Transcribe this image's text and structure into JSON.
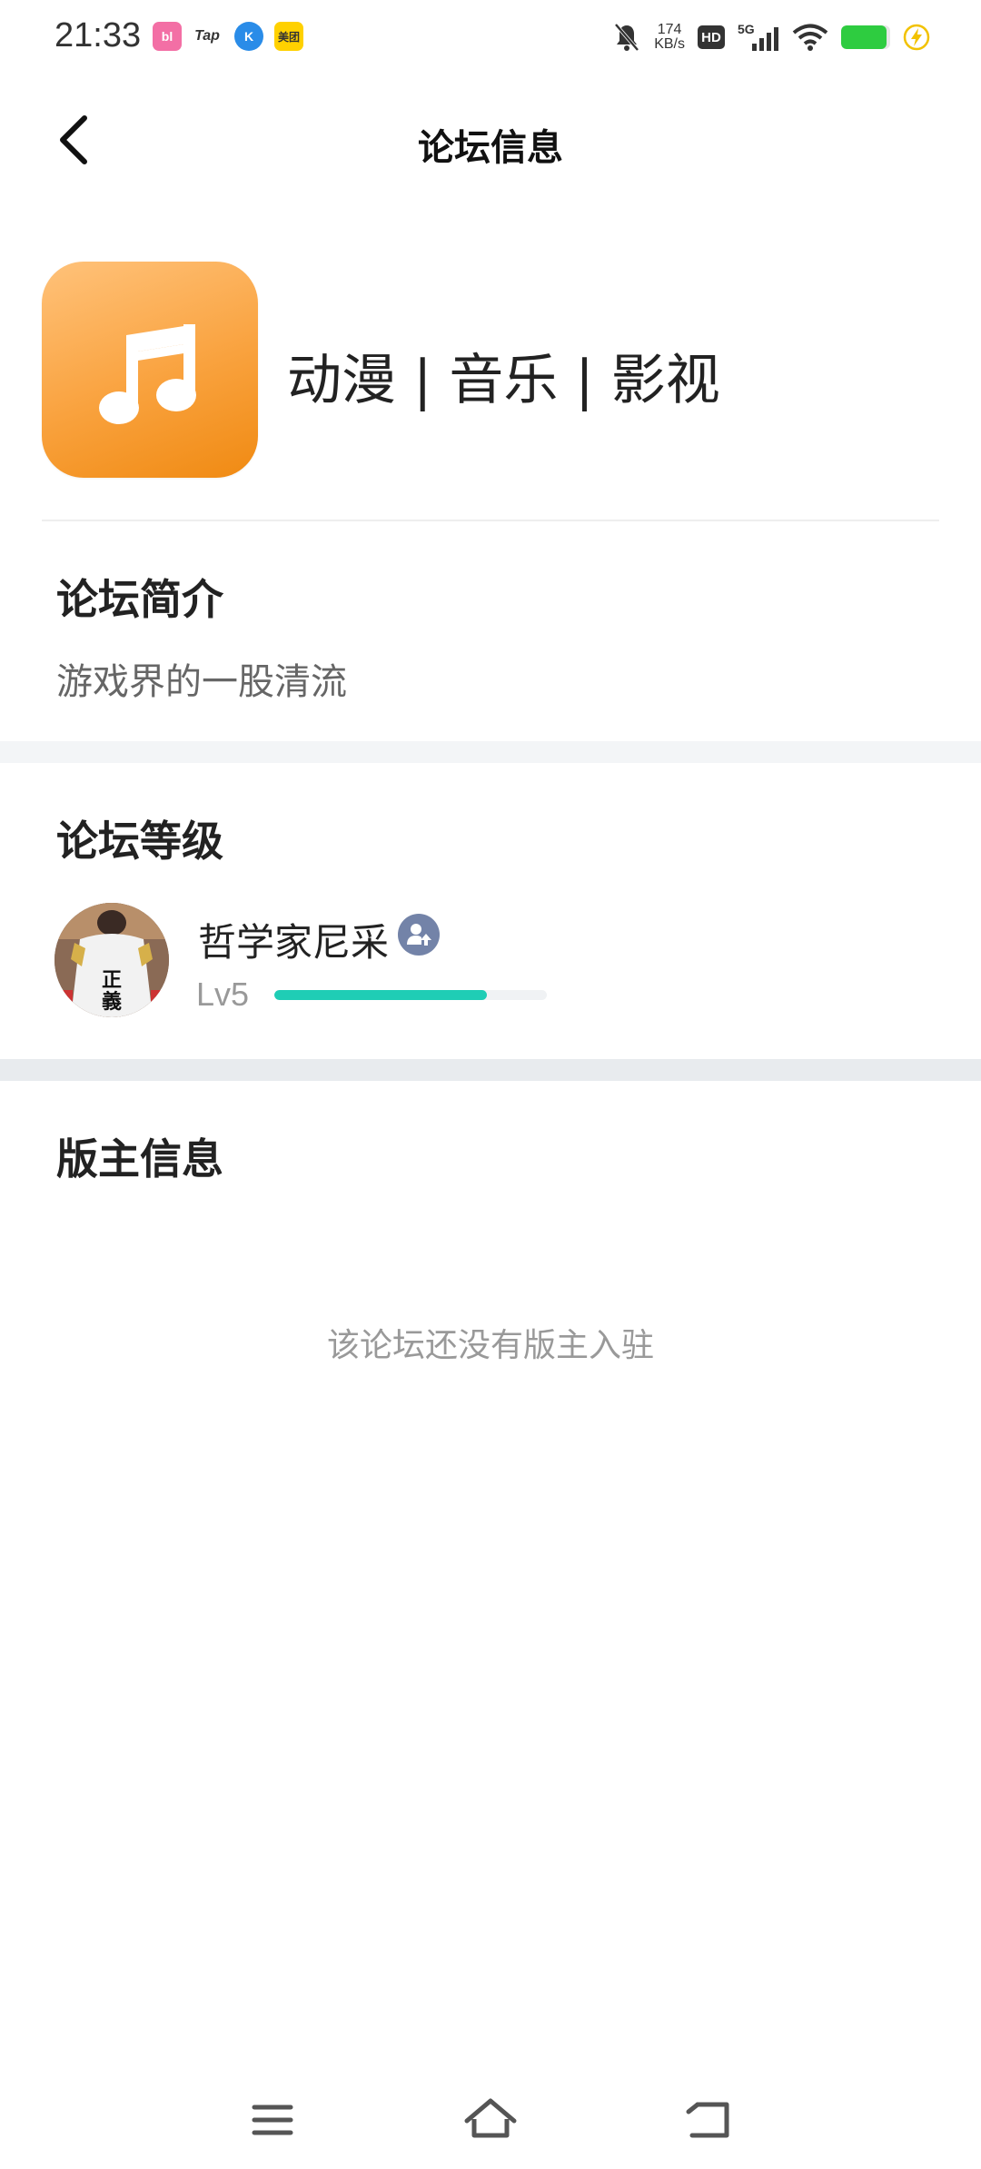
{
  "status_bar": {
    "time": "21:33",
    "app_icons": [
      {
        "name": "bilibili-icon",
        "label": "bili",
        "color": "#f36fa5"
      },
      {
        "name": "taptap-icon",
        "label": "Tap",
        "color": "#ffffff"
      },
      {
        "name": "k-app-icon",
        "label": "K",
        "color": "#2a8ce8"
      },
      {
        "name": "meituan-icon",
        "label": "美团",
        "color": "#ffd100"
      }
    ],
    "net_speed_value": "174",
    "net_speed_unit": "KB/s",
    "hd_label": "HD",
    "network_label": "5G",
    "battery_level": 0.92,
    "charging": true
  },
  "nav": {
    "title": "论坛信息"
  },
  "forum": {
    "name": "动漫 | 音乐 | 影视",
    "icon": "music-note-icon",
    "icon_gradient": [
      "#ffc27a",
      "#f08a12"
    ]
  },
  "intro": {
    "title": "论坛简介",
    "text": "游戏界的一股清流"
  },
  "level": {
    "title": "论坛等级",
    "user": {
      "name": "哲学家尼采",
      "level": "Lv5",
      "progress": 0.78,
      "progress_color": "#1fcdb5"
    }
  },
  "moderator": {
    "title": "版主信息",
    "empty_text": "该论坛还没有版主入驻"
  },
  "system_nav": [
    "menu-icon",
    "home-icon",
    "back-icon"
  ]
}
